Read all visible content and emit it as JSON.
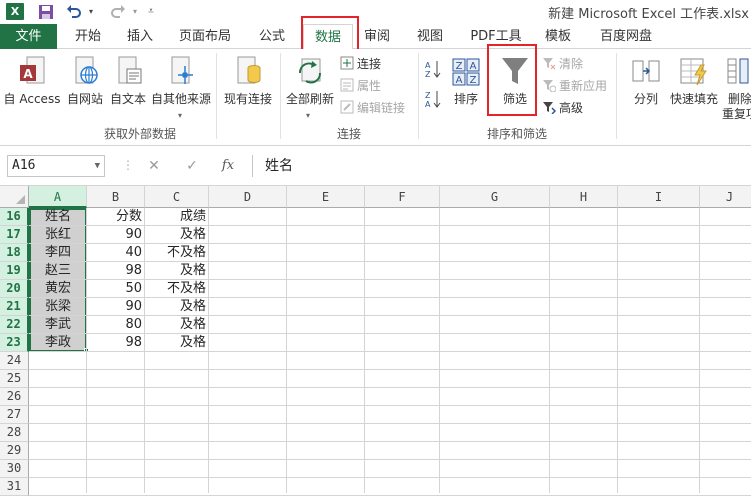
{
  "window": {
    "app_logo": "X",
    "title": "新建 Microsoft Excel 工作表.xlsx",
    "quick_access": [
      "save-icon",
      "undo-icon",
      "redo-icon",
      "customize-icon"
    ]
  },
  "tabs": [
    {
      "label": "文件"
    },
    {
      "label": "开始"
    },
    {
      "label": "插入"
    },
    {
      "label": "页面布局"
    },
    {
      "label": "公式"
    },
    {
      "label": "数据"
    },
    {
      "label": "审阅"
    },
    {
      "label": "视图"
    },
    {
      "label": "PDF工具"
    },
    {
      "label": "模板"
    },
    {
      "label": "百度网盘"
    }
  ],
  "active_tab": "数据",
  "ribbon": {
    "external_data": {
      "label": "获取外部数据",
      "buttons": [
        "自 Access",
        "自网站",
        "自文本",
        "自其他来源",
        "现有连接"
      ]
    },
    "connections": {
      "label": "连接",
      "refresh_all": "全部刷新",
      "small": [
        "连接",
        "属性",
        "编辑链接"
      ]
    },
    "sort_filter": {
      "label": "排序和筛选",
      "sort": "排序",
      "filter": "筛选",
      "small": [
        "清除",
        "重新应用",
        "高级"
      ]
    },
    "data_tools": {
      "split": "分列",
      "flash_fill": "快速填充",
      "remove_dup_line1": "删除",
      "remove_dup_line2": "重复项"
    }
  },
  "formula_bar": {
    "name_box": "A16",
    "fx": "fx",
    "content": "姓名"
  },
  "columns": [
    "A",
    "B",
    "C",
    "D",
    "E",
    "F",
    "G",
    "H",
    "I",
    "J"
  ],
  "rows": [
    "16",
    "17",
    "18",
    "19",
    "20",
    "21",
    "22",
    "23",
    "24",
    "25",
    "26",
    "27",
    "28",
    "29",
    "30",
    "31"
  ],
  "table": [
    [
      "姓名",
      "分数",
      "成绩"
    ],
    [
      "张红",
      "90",
      "及格"
    ],
    [
      "李四",
      "40",
      "不及格"
    ],
    [
      "赵三",
      "98",
      "及格"
    ],
    [
      "黄宏",
      "50",
      "不及格"
    ],
    [
      "张梁",
      "90",
      "及格"
    ],
    [
      "李武",
      "80",
      "及格"
    ],
    [
      "李政",
      "98",
      "及格"
    ]
  ],
  "colors": {
    "excel_green": "#217346",
    "highlight_red": "#e2242b",
    "selection_gray": "#d0d0d0"
  }
}
